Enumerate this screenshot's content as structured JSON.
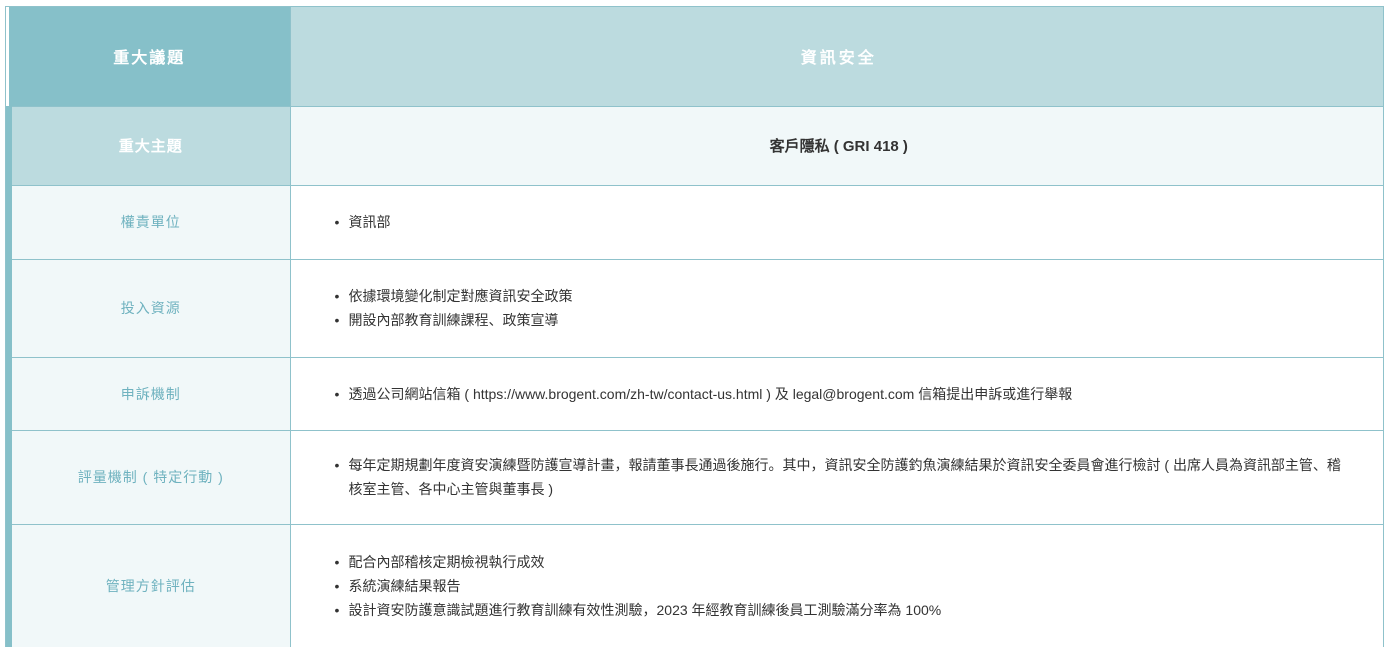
{
  "header": {
    "label": "重大議題",
    "value": "資訊安全"
  },
  "topic": {
    "label": "重大主題",
    "value": "客戶隱私 ( GRI 418 )"
  },
  "rows": [
    {
      "label": "權責單位",
      "items": [
        "資訊部"
      ]
    },
    {
      "label": "投入資源",
      "items": [
        "依據環境變化制定對應資訊安全政策",
        "開設內部教育訓練課程、政策宣導"
      ]
    },
    {
      "label": "申訴機制",
      "items": [
        "透過公司網站信箱 ( https://www.brogent.com/zh-tw/contact-us.html ) 及 legal@brogent.com 信箱提出申訴或進行舉報"
      ]
    },
    {
      "label": "評量機制 ( 特定行動 )",
      "items": [
        "每年定期規劃年度資安演練暨防護宣導計畫，報請董事長通過後施行。其中，資訊安全防護釣魚演練結果於資訊安全委員會進行檢討 ( 出席人員為資訊部主管、稽核室主管、各中心主管與董事長 )"
      ]
    },
    {
      "label": "管理方針評估",
      "items": [
        "配合內部稽核定期檢視執行成效",
        "系統演練結果報告",
        "設計資安防護意識試題進行教育訓練有效性測驗，2023 年經教育訓練後員工測驗滿分率為 100%"
      ]
    }
  ]
}
